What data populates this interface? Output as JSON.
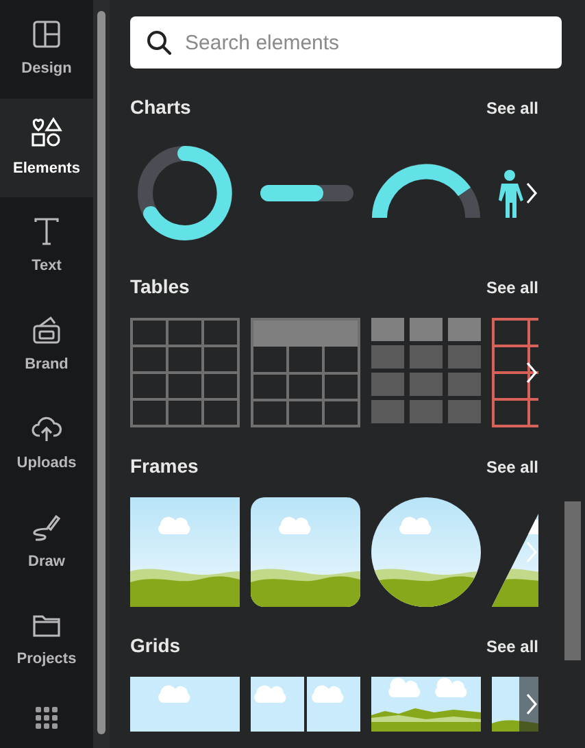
{
  "nav": [
    {
      "label": "Design",
      "selected": false
    },
    {
      "label": "Elements",
      "selected": true
    },
    {
      "label": "Text",
      "selected": false
    },
    {
      "label": "Brand",
      "selected": false
    },
    {
      "label": "Uploads",
      "selected": false
    },
    {
      "label": "Draw",
      "selected": false
    },
    {
      "label": "Projects",
      "selected": false
    }
  ],
  "search": {
    "placeholder": "Search elements"
  },
  "sections": [
    {
      "title": "Charts",
      "see_all": "See all",
      "tiles": [
        {
          "kind": "donut"
        },
        {
          "kind": "progress"
        },
        {
          "kind": "gauge"
        },
        {
          "kind": "figure"
        }
      ]
    },
    {
      "title": "Tables",
      "see_all": "See all",
      "tiles": [
        {
          "kind": "grid"
        },
        {
          "kind": "header"
        },
        {
          "kind": "blocks"
        },
        {
          "kind": "red"
        }
      ]
    },
    {
      "title": "Frames",
      "see_all": "See all",
      "tiles": [
        {
          "kind": "square"
        },
        {
          "kind": "rounded"
        },
        {
          "kind": "circle"
        },
        {
          "kind": "triangle"
        }
      ]
    },
    {
      "title": "Grids",
      "see_all": "See all",
      "tiles": [
        {
          "kind": "single"
        },
        {
          "kind": "split"
        },
        {
          "kind": "panorama"
        },
        {
          "kind": "faded"
        }
      ]
    }
  ]
}
